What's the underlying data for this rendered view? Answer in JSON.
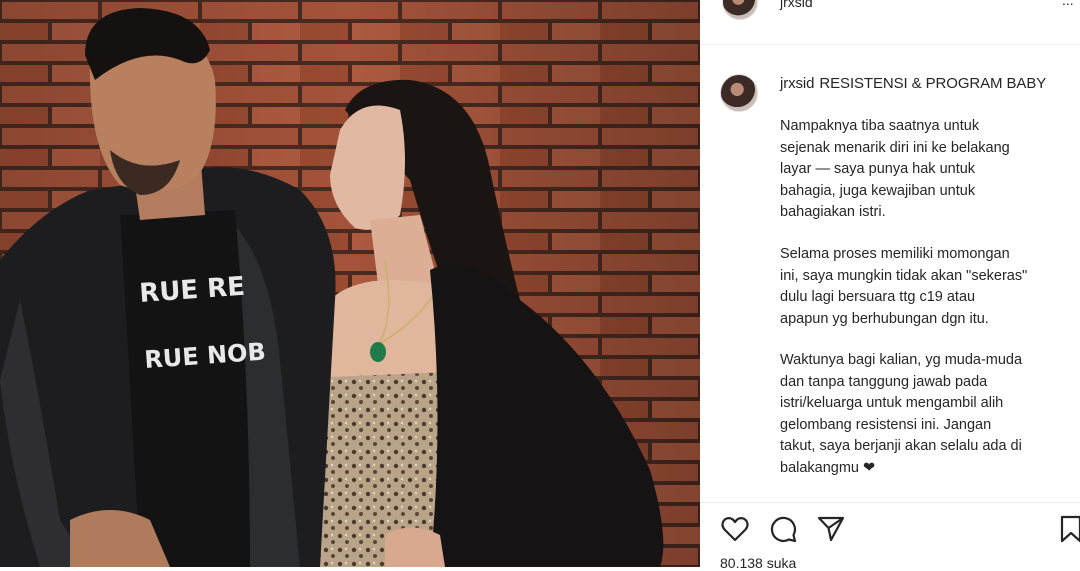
{
  "post": {
    "username": "jrxsid",
    "more_label": "...",
    "caption": {
      "username": "jrxsid",
      "title": "RESISTENSI & PROGRAM BABY",
      "paragraphs": [
        [
          "Nampaknya tiba saatnya untuk",
          "sejenak menarik diri ini ke belakang",
          "layar — saya punya hak untuk",
          "bahagia, juga kewajiban untuk",
          "bahagiakan istri."
        ],
        [
          "Selama proses memiliki momongan",
          "ini, saya mungkin tidak akan \"sekeras\"",
          "dulu lagi bersuara ttg c19 atau",
          "apapun yg berhubungan dgn itu."
        ],
        [
          "Waktunya bagi kalian, yg muda-muda",
          "dan tanpa tanggung jawab pada",
          "istri/keluarga untuk mengambil alih",
          "gelombang resistensi ini. Jangan",
          "takut, saya berjanji akan selalu ada di",
          "balakangmu ❤"
        ]
      ]
    },
    "likes_text": "80.138 suka",
    "photo_shirt_text": [
      "RUE RE",
      "RUE NOB"
    ]
  },
  "icons": {
    "like": "heart-icon",
    "comment": "comment-icon",
    "share": "send-icon",
    "save": "bookmark-icon"
  },
  "colors": {
    "text": "#262626",
    "divider": "#efefef",
    "brick": "#9a4a30"
  }
}
